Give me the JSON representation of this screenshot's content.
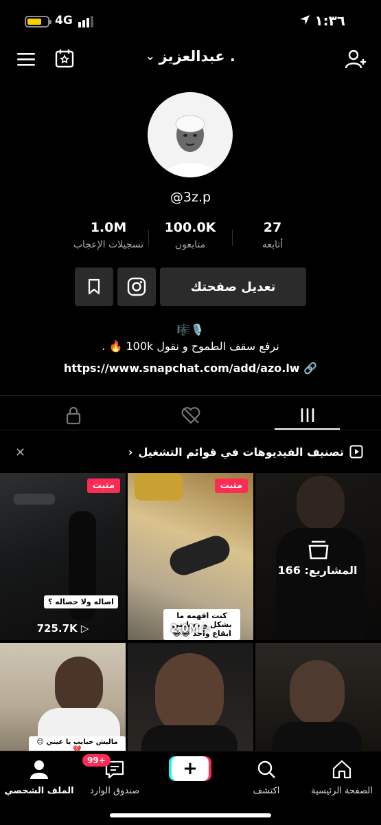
{
  "status_bar": {
    "network": "4G",
    "time": "١:٣٦"
  },
  "header": {
    "username": "عبدالعزيز ."
  },
  "profile": {
    "handle": "@3z.p",
    "stats": [
      {
        "value": "1.0M",
        "label": "تسجيلات الإعجاب"
      },
      {
        "value": "100.0K",
        "label": "متابعون"
      },
      {
        "value": "27",
        "label": "أتابعه"
      }
    ],
    "edit_button": "تعديل صفحتك",
    "bio_emojis": "🎼🎙️",
    "bio": "نرفع سقف الطموح و نقول 100k 🔥 .",
    "link": "https://www.snapchat.com/add/azo.lw"
  },
  "playlist_banner": {
    "label": "تصنيف الفيديوهات في قوائم التشغيل"
  },
  "videos": [
    {
      "pinned": "مثبت",
      "caption": "اصاله ولا حصاله ؟",
      "views": "725.7K"
    },
    {
      "pinned": "مثبت",
      "caption": "كنت افهمه ما بشكل و بعطيني ايقاع واحد 😂😂",
      "views": "2.0M"
    },
    {
      "projects": "المشاريع: 166"
    },
    {
      "caption": "ماليش حبايب يا عيني 😊💔"
    },
    {},
    {}
  ],
  "nav": {
    "home": "الصفحة الرئيسية",
    "discover": "اكتشف",
    "create": "+",
    "inbox": "صندوق الوارد",
    "inbox_badge": "99+",
    "profile": "الملف الشخصي"
  },
  "colors": {
    "accent": "#fe2c55",
    "cyan": "#25f4ee",
    "battery": "#f5d000"
  }
}
